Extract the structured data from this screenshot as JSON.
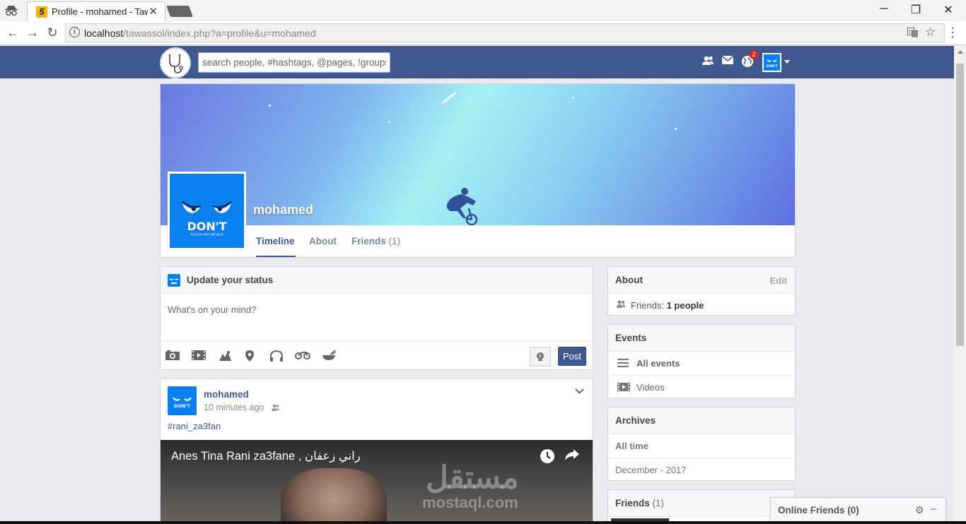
{
  "browser": {
    "tab_title": "Profile - mohamed - Tawassol",
    "tab_favicon": "5",
    "url_host": "localhost",
    "url_path": "/tawassol/index.php?a=profile&u=mohamed"
  },
  "header": {
    "search_placeholder": "search people, #hashtags, @pages, !groups",
    "notification_count": "2"
  },
  "profile": {
    "name": "mohamed",
    "avatar_text": "DON'T",
    "avatar_subtext": "TOUCH MY DEVICE",
    "tabs": [
      {
        "label": "Timeline",
        "active": true
      },
      {
        "label": "About"
      },
      {
        "label": "Friends",
        "count": "(1)"
      }
    ]
  },
  "status": {
    "title": "Update your status",
    "placeholder": "What's on your mind?",
    "post_label": "Post"
  },
  "post": {
    "author": "mohamed",
    "time": "10 minutes ago",
    "hashtag": "#rani_za3fan",
    "video_title": "Anes Tina Rani za3fane , راني زعفان",
    "watermark_ar": "مستقل",
    "watermark_en": "mostaql.com"
  },
  "sidebar": {
    "about": {
      "title": "About",
      "edit": "Edit",
      "friends_label": "Friends:",
      "friends_value": "1 people"
    },
    "events": {
      "title": "Events",
      "items": [
        "All events",
        "Videos"
      ]
    },
    "archives": {
      "title": "Archives",
      "items": [
        "All time",
        "December - 2017"
      ]
    },
    "friends": {
      "title": "Friends",
      "count": "(1)"
    }
  },
  "online_friends": {
    "title": "Online Friends (0)"
  },
  "colors": {
    "brand": "#41588f",
    "avatar_blue": "#0a7ff0",
    "badge": "#e02020"
  }
}
